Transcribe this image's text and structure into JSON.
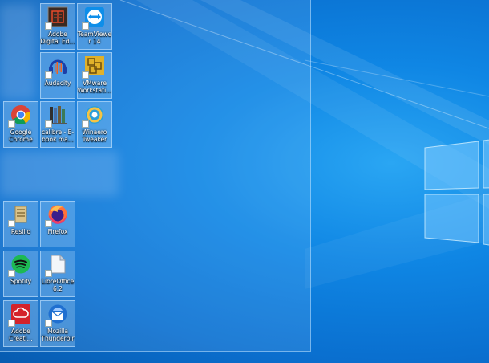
{
  "desktop": {
    "icons": [
      {
        "id": "adobe-digital",
        "label": "Adobe Digital Ed...",
        "icon": "adobe-digital-editions-icon",
        "color": "#2b2b2b"
      },
      {
        "id": "teamviewer",
        "label": "TeamViewer 14",
        "icon": "teamviewer-icon",
        "color": "#0e8ee9"
      },
      {
        "id": "audacity",
        "label": "Audacity",
        "icon": "audacity-icon",
        "color": "#1b3fa8"
      },
      {
        "id": "vmware",
        "label": "VMware Workstati...",
        "icon": "vmware-workstation-icon",
        "color": "#e0b12a"
      },
      {
        "id": "chrome",
        "label": "Google Chrome",
        "icon": "chrome-icon",
        "color": "#4285f4"
      },
      {
        "id": "calibre",
        "label": "calibre - E-book ma...",
        "icon": "calibre-icon",
        "color": "#5a4a3a"
      },
      {
        "id": "winaero",
        "label": "Winaero Tweaker",
        "icon": "winaero-tweaker-icon",
        "color": "#2c9fd8"
      },
      {
        "id": "resilio",
        "label": "Resilio",
        "icon": "resilio-icon",
        "color": "#d9c38a"
      },
      {
        "id": "firefox",
        "label": "Firefox",
        "icon": "firefox-icon",
        "color": "#ff7139"
      },
      {
        "id": "spotify",
        "label": "Spotify",
        "icon": "spotify-icon",
        "color": "#1db954"
      },
      {
        "id": "libreoffice",
        "label": "LibreOffice 6.2",
        "icon": "libreoffice-icon",
        "color": "#e8eef5"
      },
      {
        "id": "adobe-cc",
        "label": "Adobe Creati...",
        "icon": "adobe-creative-cloud-icon",
        "color": "#d4232b"
      },
      {
        "id": "thunderbird",
        "label": "Mozilla Thunderbird",
        "icon": "thunderbird-icon",
        "color": "#1f6fd0"
      }
    ]
  }
}
